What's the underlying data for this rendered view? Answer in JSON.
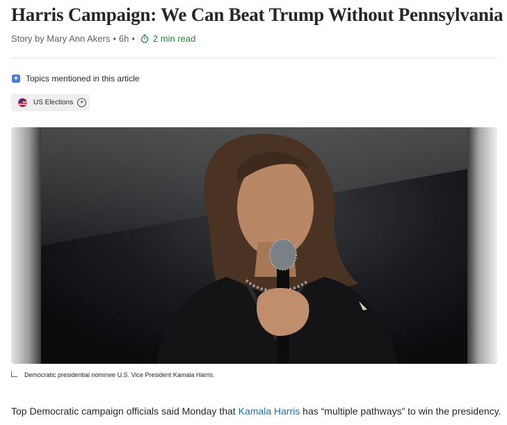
{
  "article": {
    "headline": "Harris Campaign: We Can Beat Trump Without Pennsylvania",
    "byline": {
      "author": "Story by Mary Ann Akers",
      "separator": "•",
      "age": "6h",
      "read_time": "2 min read"
    }
  },
  "topics": {
    "heading": "Topics mentioned in this article",
    "items": [
      {
        "label": "US Elections",
        "icon": "us-flag-icon"
      }
    ]
  },
  "photo": {
    "subject": "kamala-harris-speaking-photo",
    "caption": "Democratic presidential nominee U.S. Vice President Kamala Harris."
  },
  "body": {
    "lead_before": "Top Democratic campaign officials said Monday that ",
    "lead_link": "Kamala Harris",
    "lead_after": " has “multiple pathways” to win the presidency."
  },
  "colors": {
    "link": "#1a73c8",
    "read_time": "#1e8a3c",
    "topics_icon": "#4a7be3"
  }
}
